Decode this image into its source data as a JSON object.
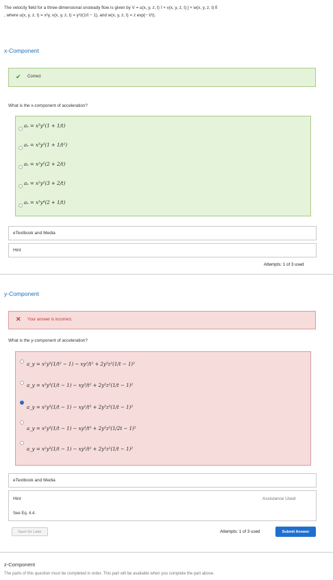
{
  "intro": {
    "line1": "The velocity field for a three-dimensional unsteady flow is given by V = u(x, y, z, t) î + v(x, y, z, t) ĵ + w(x, y, z, t) k̂",
    "line2": ", where u(x, y, z, t) = x²y, v(x, y, z, t) = y²z(1/t − 1), and w(x, y, z, t) = z exp(− t/τ)."
  },
  "x_component": {
    "title": "x-Component",
    "status": "Correct",
    "question": "What is the x-component of acceleration?",
    "choices": [
      "aₓ = x³y²(1 + 1/t)",
      "aₓ = x³y³(1 + 1/t²)",
      "aₓ = x²y²(2 + 2/t)",
      "aₓ = x²y²(3 + 2/t)",
      "aₓ = x³y⁴(2 + 1/t)"
    ],
    "etextbook": "eTextbook and Media",
    "hint": "Hint",
    "attempts": "Attempts: 1 of 3 used"
  },
  "y_component": {
    "title": "y-Component",
    "status": "Your answer is incorrect.",
    "question": "What is the y-component of acceleration?",
    "choices": [
      "a_y = x²y³(1/t² − 1) − xy²/t² + 2y³z²(1/t − 1)²",
      "a_y = x³y³(1/t − 1) − xy³/t² + 2y³z²(1/t − 1)²",
      "a_y = x²y³(1/t − 1) − xy²/t³ + 2y³z³(1/t − 1)²",
      "a_y = x²y³(1/t − 1) − xy³/t³ + 2y³z³(1/2t − 1)²",
      "a_y = x²y³(1/t − 1) − xy²/t² + 2y³z²(1/t − 1)²"
    ],
    "selected_index": 2,
    "etextbook": "eTextbook and Media",
    "hint": "Hint",
    "hint_text": "See Eq. 4.4.",
    "assistance": "Assistance Used",
    "save_label": "Save for Later",
    "attempts": "Attempts: 1 of 3 used",
    "submit_label": "Submit Answer"
  },
  "z_component": {
    "title": "z-Component",
    "note": "The parts of this question must be completed in order. This part will be available when you complete the part above."
  },
  "colors": {
    "link_blue": "#1a6fb5",
    "correct_bg": "#e5f3da",
    "wrong_bg": "#f7dcdc",
    "button_blue": "#1f6fd0"
  }
}
